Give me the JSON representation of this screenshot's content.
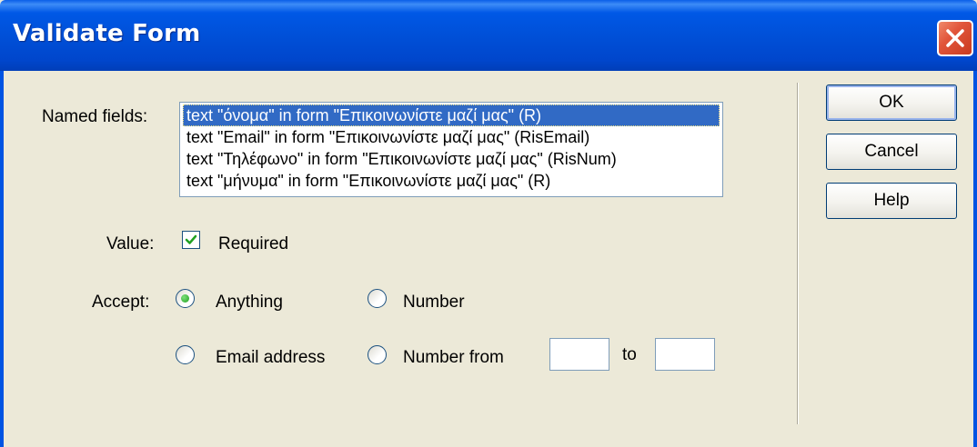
{
  "window": {
    "title": "Validate Form"
  },
  "fields": {
    "named_fields_label": "Named fields:",
    "items": [
      {
        "label": "text \"όνομα\" in form \"Επικοινωνίστε μαζί μας\" (R)",
        "selected": true
      },
      {
        "label": "text \"Email\" in form \"Επικοινωνίστε μαζί μας\" (RisEmail)",
        "selected": false
      },
      {
        "label": "text \"Τηλέφωνο\" in form \"Επικοινωνίστε μαζί μας\" (RisNum)",
        "selected": false
      },
      {
        "label": "text \"μήνυμα\" in form \"Επικοινωνίστε μαζί μας\" (R)",
        "selected": false
      }
    ]
  },
  "value": {
    "label": "Value:",
    "required_label": "Required",
    "required_checked": true
  },
  "accept": {
    "label": "Accept:",
    "options": {
      "anything": "Anything",
      "number": "Number",
      "email": "Email address",
      "number_from": "Number from"
    },
    "selected": "anything",
    "range_to_label": "to",
    "range_from_value": "",
    "range_to_value": ""
  },
  "buttons": {
    "ok": "OK",
    "cancel": "Cancel",
    "help": "Help"
  },
  "colors": {
    "titlebar": "#0054e3",
    "selection": "#316ac5",
    "dialog_bg": "#ece9d8",
    "close_button": "#e1553a"
  }
}
